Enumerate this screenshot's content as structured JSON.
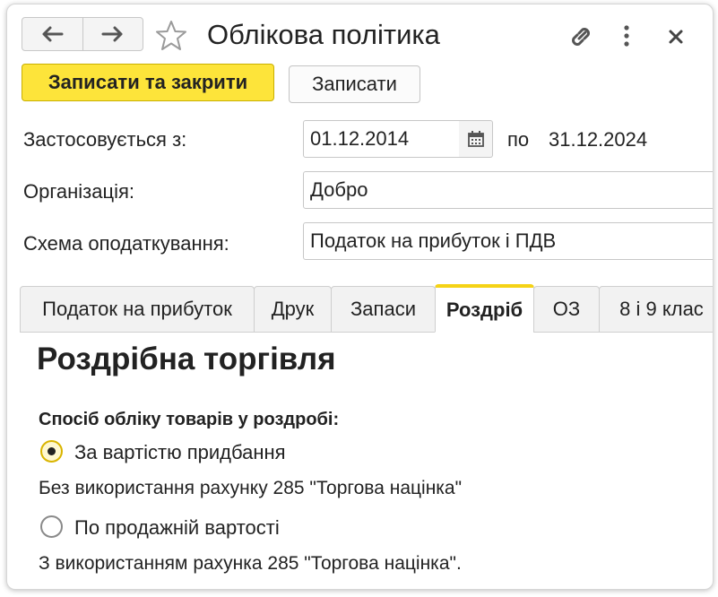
{
  "window": {
    "title": "Облікова політика",
    "back_icon": "arrow-left-icon",
    "forward_icon": "arrow-right-icon",
    "favorite_icon": "star-outline-icon",
    "link_icon": "link-icon",
    "more_icon": "more-vertical-icon",
    "close_icon": "close-icon"
  },
  "toolbar": {
    "save_close_label": "Записати та закрити",
    "save_label": "Записати"
  },
  "form": {
    "applies_from_label": "Застосовується з:",
    "applies_from_value": "01.12.2014",
    "to_label": "по",
    "to_value": "31.12.2024",
    "organization_label": "Організація:",
    "organization_value": "Добро",
    "tax_scheme_label": "Схема оподаткування:",
    "tax_scheme_value": "Податок на прибуток і ПДВ"
  },
  "tabs": [
    {
      "label": "Податок на прибуток",
      "active": false
    },
    {
      "label": "Друк",
      "active": false
    },
    {
      "label": "Запаси",
      "active": false
    },
    {
      "label": "Роздріб",
      "active": true
    },
    {
      "label": "ОЗ",
      "active": false
    },
    {
      "label": "8 і 9 клас",
      "active": false
    }
  ],
  "retail": {
    "title": "Роздрібна торгівля",
    "method_label": "Спосіб обліку товарів у роздробі:",
    "options": [
      {
        "label": "За вартістю придбання",
        "description": "Без використання рахунку 285 \"Торгова націнка\"",
        "selected": true
      },
      {
        "label": "По продажній вартості",
        "description": "З використанням рахунка 285 \"Торгова націнка\".",
        "selected": false
      }
    ]
  },
  "colors": {
    "accent": "#fde43a",
    "active_tab_border": "#f5d316"
  }
}
